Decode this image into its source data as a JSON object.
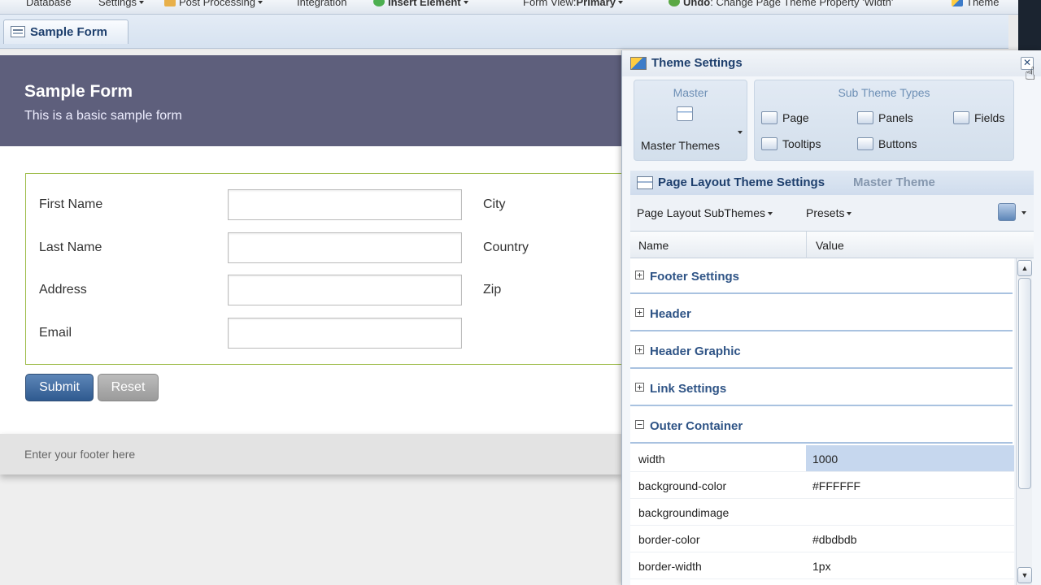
{
  "toolbar": {
    "database": "Database",
    "settings": "Settings",
    "post_processing": "Post Processing",
    "integration": "Integration",
    "insert_element": "Insert Element",
    "form_view": "Form View:",
    "form_view_value": "Primary",
    "undo": "Undo",
    "undo_detail": ": Change Page Theme Property 'Width'",
    "theme": "Theme"
  },
  "tabs": {
    "sample_form": "Sample Form"
  },
  "form": {
    "title": "Sample Form",
    "subtitle": "This is a basic sample form",
    "labels": {
      "first_name": "First Name",
      "last_name": "Last Name",
      "address": "Address",
      "email": "Email",
      "city": "City",
      "country": "Country",
      "zip": "Zip"
    },
    "submit": "Submit",
    "reset": "Reset",
    "footer": "Enter your footer here"
  },
  "panel": {
    "title": "Theme Settings",
    "close": "✕",
    "master_group": "Master",
    "master_themes": "Master Themes",
    "sub_group": "Sub Theme Types",
    "sub_types": {
      "page": "Page",
      "panels": "Panels",
      "fields": "Fields",
      "tooltips": "Tooltips",
      "buttons": "Buttons"
    },
    "layout_title": "Page Layout Theme Settings",
    "layout_subtitle": "Master Theme",
    "subthemes_dd": "Page Layout SubThemes",
    "presets_dd": "Presets",
    "col_name": "Name",
    "col_value": "Value",
    "groups": {
      "footer_settings": "Footer Settings",
      "header": "Header",
      "header_graphic": "Header Graphic",
      "link_settings": "Link Settings",
      "outer_container": "Outer Container"
    },
    "expand": "+",
    "collapse": "−",
    "props": {
      "width": {
        "name": "width",
        "value": "1000"
      },
      "background_color": {
        "name": "background-color",
        "value": "#FFFFFF"
      },
      "background_image": {
        "name": "backgroundimage",
        "value": ""
      },
      "border_color": {
        "name": "border-color",
        "value": "#dbdbdb"
      },
      "border_width": {
        "name": "border-width",
        "value": "1px"
      }
    }
  },
  "colors": {
    "header_bg": "#5e5f7c",
    "accent": "#1e3f6d",
    "field_border": "#9ebc4a",
    "submit_bg": "#3d6aa2",
    "selected_value": "#c6d7ee"
  }
}
